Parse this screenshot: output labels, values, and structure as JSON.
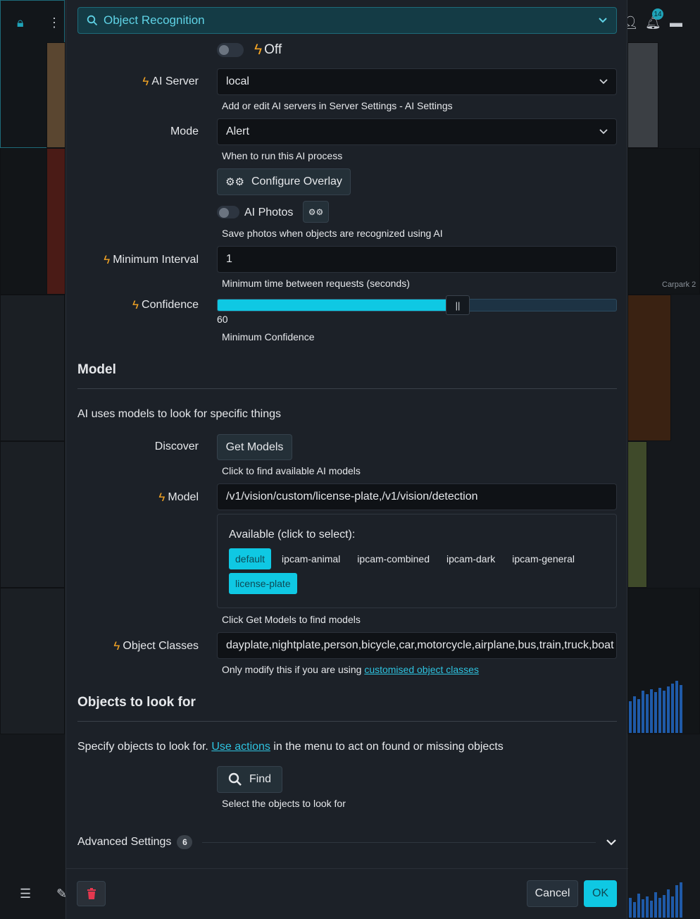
{
  "background": {
    "notification_count": "14",
    "camera_label": "Carpark 2"
  },
  "header": {
    "object_recognition_label": "Object Recognition"
  },
  "enable": {
    "state_label": "Off"
  },
  "ai_server": {
    "label": "AI Server",
    "value": "local",
    "help": "Add or edit AI servers in Server Settings - AI Settings"
  },
  "mode": {
    "label": "Mode",
    "value": "Alert",
    "help": "When to run this AI process"
  },
  "overlay": {
    "button_label": "Configure Overlay"
  },
  "ai_photos": {
    "label": "AI Photos",
    "help": "Save photos when objects are recognized using AI"
  },
  "min_interval": {
    "label": "Minimum Interval",
    "value": "1",
    "help": "Minimum time between requests (seconds)"
  },
  "confidence": {
    "label": "Confidence",
    "value": 60,
    "value_text": "60",
    "help": "Minimum Confidence",
    "fraction": 0.574
  },
  "model_section": {
    "title": "Model",
    "description": "AI uses models to look for specific things",
    "discover_label": "Discover",
    "get_models_label": "Get Models",
    "discover_help": "Click to find available AI models",
    "model_label": "Model",
    "model_value": "/v1/vision/custom/license-plate,/v1/vision/detection",
    "available_title": "Available (click to select):",
    "available_models": [
      {
        "name": "default",
        "selected": true
      },
      {
        "name": "ipcam-animal",
        "selected": false
      },
      {
        "name": "ipcam-combined",
        "selected": false
      },
      {
        "name": "ipcam-dark",
        "selected": false
      },
      {
        "name": "ipcam-general",
        "selected": false
      },
      {
        "name": "license-plate",
        "selected": true
      }
    ],
    "available_help": "Click Get Models to find models",
    "classes_label": "Object Classes",
    "classes_value": "dayplate,nightplate,person,bicycle,car,motorcycle,airplane,bus,train,truck,boat",
    "classes_help_prefix": "Only modify this if you are using ",
    "classes_help_link": "customised object classes"
  },
  "objects_section": {
    "title": "Objects to look for",
    "desc_prefix": "Specify objects to look for. ",
    "desc_link": "Use actions",
    "desc_suffix": " in the menu to act on found or missing objects",
    "find_label": "Find",
    "find_help": "Select the objects to look for"
  },
  "advanced": {
    "label": "Advanced Settings",
    "count": "6"
  },
  "footer": {
    "cancel_label": "Cancel",
    "ok_label": "OK"
  },
  "colors": {
    "accent": "#0fc8e3",
    "bolt": "#f5a524",
    "danger": "#e5384f"
  }
}
